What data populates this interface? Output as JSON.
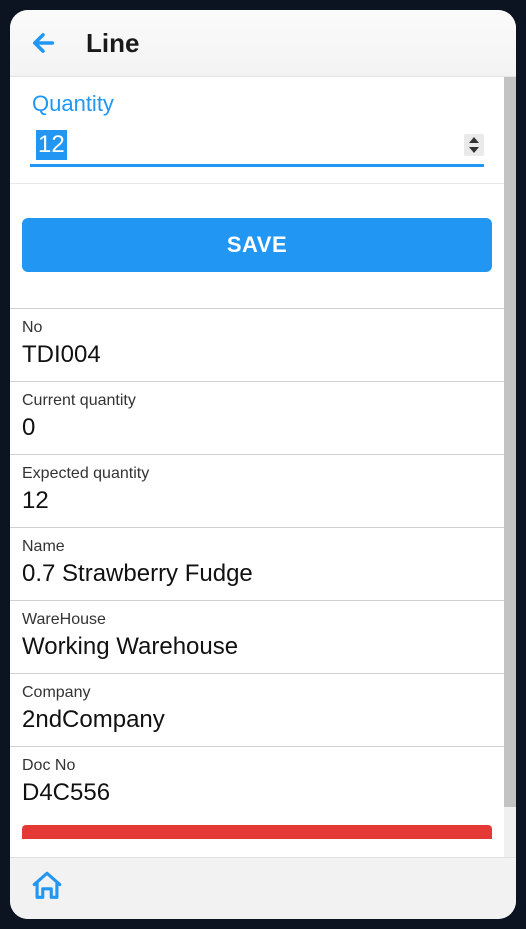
{
  "header": {
    "title": "Line"
  },
  "quantity": {
    "label": "Quantity",
    "value": "12"
  },
  "actions": {
    "save_label": "SAVE"
  },
  "details": [
    {
      "label": "No",
      "value": "TDI004"
    },
    {
      "label": "Current quantity",
      "value": "0"
    },
    {
      "label": "Expected quantity",
      "value": "12"
    },
    {
      "label": "Name",
      "value": "0.7 Strawberry Fudge"
    },
    {
      "label": "WareHouse",
      "value": "Working Warehouse"
    },
    {
      "label": "Company",
      "value": "2ndCompany"
    },
    {
      "label": "Doc No",
      "value": "D4C556"
    }
  ],
  "colors": {
    "blue": "#2196F3",
    "danger": "#E53935"
  }
}
